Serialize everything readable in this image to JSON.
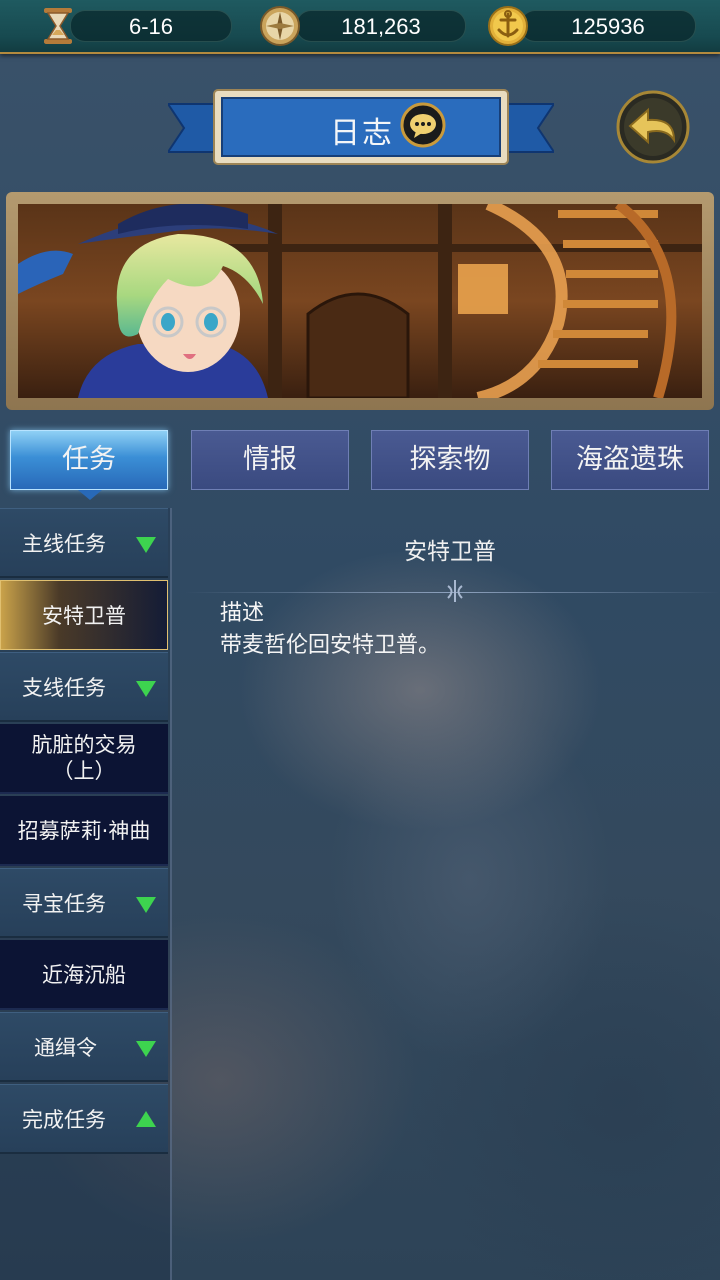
{
  "resources": {
    "date": "6-16",
    "compass_value": "181,263",
    "anchor_coins": "125936"
  },
  "header": {
    "title": "日志",
    "chat_icon": "chat-bubble-icon",
    "back_icon": "back-arrow-icon"
  },
  "tabs": [
    {
      "label": "任务",
      "active": true
    },
    {
      "label": "情报",
      "active": false
    },
    {
      "label": "探索物",
      "active": false
    },
    {
      "label": "海盗遗珠",
      "active": false
    }
  ],
  "sidebar": {
    "items": [
      {
        "label": "主线任务",
        "type": "category",
        "arrow": "down"
      },
      {
        "label": "安特卫普",
        "type": "quest",
        "selected": true
      },
      {
        "label": "支线任务",
        "type": "category",
        "arrow": "down"
      },
      {
        "label": "肮脏的交易",
        "label2": "（上）",
        "type": "quest"
      },
      {
        "label": "招募萨莉·神曲",
        "type": "quest"
      },
      {
        "label": "寻宝任务",
        "type": "category",
        "arrow": "down"
      },
      {
        "label": "近海沉船",
        "type": "quest"
      },
      {
        "label": "通缉令",
        "type": "category",
        "arrow": "down"
      },
      {
        "label": "完成任务",
        "type": "category",
        "arrow": "up"
      }
    ]
  },
  "detail": {
    "title": "安特卫普",
    "desc_label": "描述",
    "desc_text": "带麦哲伦回安特卫普。"
  },
  "colors": {
    "accent_green": "#3dd34f",
    "tab_active": "#3b8fd6",
    "gold": "#c9a24a"
  }
}
